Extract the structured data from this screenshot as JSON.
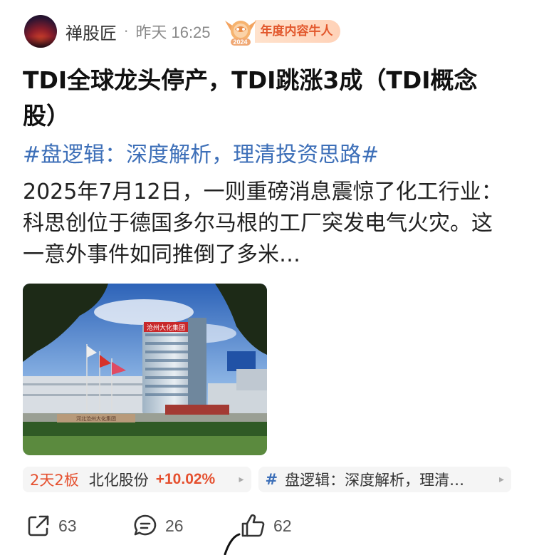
{
  "header": {
    "author": "禅股匠",
    "separator": "·",
    "time": "昨天 16:25",
    "badge_label": "年度内容牛人",
    "badge_year": "2024"
  },
  "post": {
    "title": "TDI全球龙头停产，TDI跳涨3成（TDI概念股）",
    "topic": "#盘逻辑：深度解析，理清投资思路#",
    "body": "2025年7月12日，一则重磅消息震惊了化工行业：科思创位于德国多尔马根的工厂突发电气火灾。这一意外事件如同推倒了多米…",
    "image_sign_text": "沧州大化集团",
    "image_gate_text": "河北沧州大化集团"
  },
  "chips": {
    "stock": {
      "streak": "2天2板",
      "name": "北化股份",
      "change": "+10.02%",
      "arrow": "▸"
    },
    "topic": {
      "hash": "#",
      "label": "盘逻辑：深度解析，理清…",
      "arrow": "▸"
    }
  },
  "actions": {
    "share_count": "63",
    "comment_count": "26",
    "like_count": "62"
  },
  "colors": {
    "topic_blue": "#3d6fb8",
    "stock_red": "#e5502f",
    "badge_orange": "#e2572c"
  }
}
